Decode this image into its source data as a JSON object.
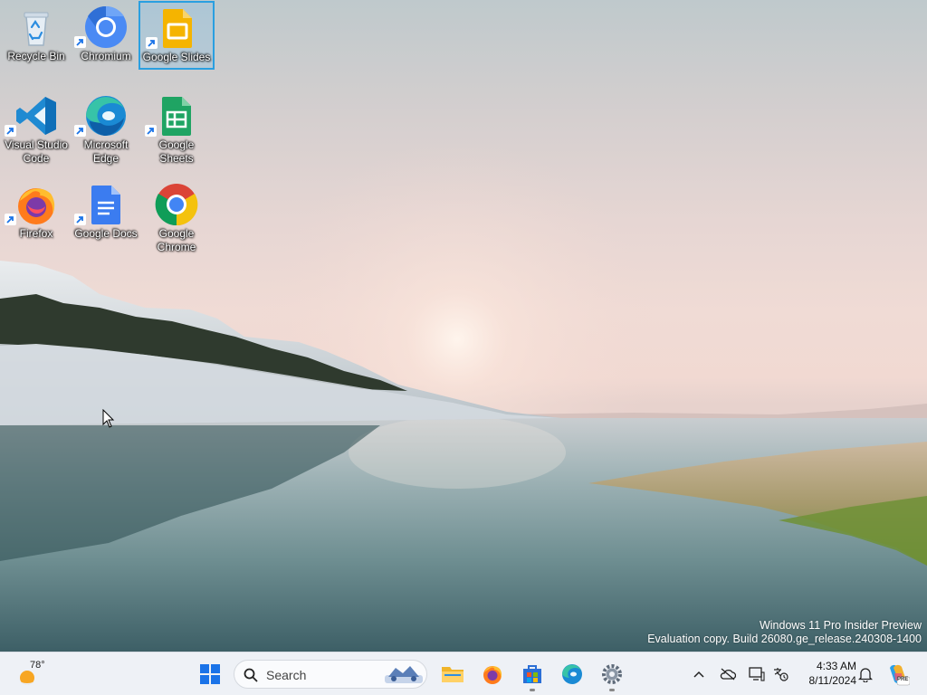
{
  "desktop": {
    "icons": [
      {
        "label": "Recycle Bin",
        "icon": "recycle-bin-icon",
        "selected": false
      },
      {
        "label": "Chromium",
        "icon": "chromium-icon",
        "selected": false
      },
      {
        "label": "Google Slides",
        "icon": "google-slides-icon",
        "selected": true
      },
      {
        "label": "Visual Studio Code",
        "icon": "vscode-icon",
        "selected": false
      },
      {
        "label": "Microsoft Edge",
        "icon": "edge-icon",
        "selected": false
      },
      {
        "label": "Google Sheets",
        "icon": "google-sheets-icon",
        "selected": false
      },
      {
        "label": "Firefox",
        "icon": "firefox-icon",
        "selected": false
      },
      {
        "label": "Google Docs",
        "icon": "google-docs-icon",
        "selected": false
      },
      {
        "label": "Google Chrome",
        "icon": "chrome-icon",
        "selected": false
      }
    ]
  },
  "watermark": {
    "line1": "Windows 11 Pro Insider Preview",
    "line2": "Evaluation copy. Build 26080.ge_release.240308-1400"
  },
  "taskbar": {
    "weather": {
      "temp": "78°",
      "icon": "sunny-weather-icon"
    },
    "start_icon": "windows-start-icon",
    "search": {
      "placeholder": "Search",
      "icon": "search-icon"
    },
    "pinned": [
      {
        "name": "file-explorer",
        "icon": "folder-icon"
      },
      {
        "name": "firefox",
        "icon": "firefox-icon"
      },
      {
        "name": "microsoft-store",
        "icon": "store-icon"
      },
      {
        "name": "edge",
        "icon": "edge-icon"
      },
      {
        "name": "settings",
        "icon": "gear-icon"
      }
    ],
    "tray": {
      "icons": [
        "chevron-up-icon",
        "onedrive-offline-icon",
        "display-icon",
        "language-icon"
      ],
      "time": "4:33 AM",
      "date": "8/11/2024",
      "notification_icon": "bell-icon",
      "copilot_icon": "copilot-icon",
      "copilot_badge": "PRE"
    }
  },
  "colors": {
    "selection_border": "#2a9fe0",
    "taskbar_bg": "#eef1f6",
    "windows_blue": "#1a73e8"
  }
}
